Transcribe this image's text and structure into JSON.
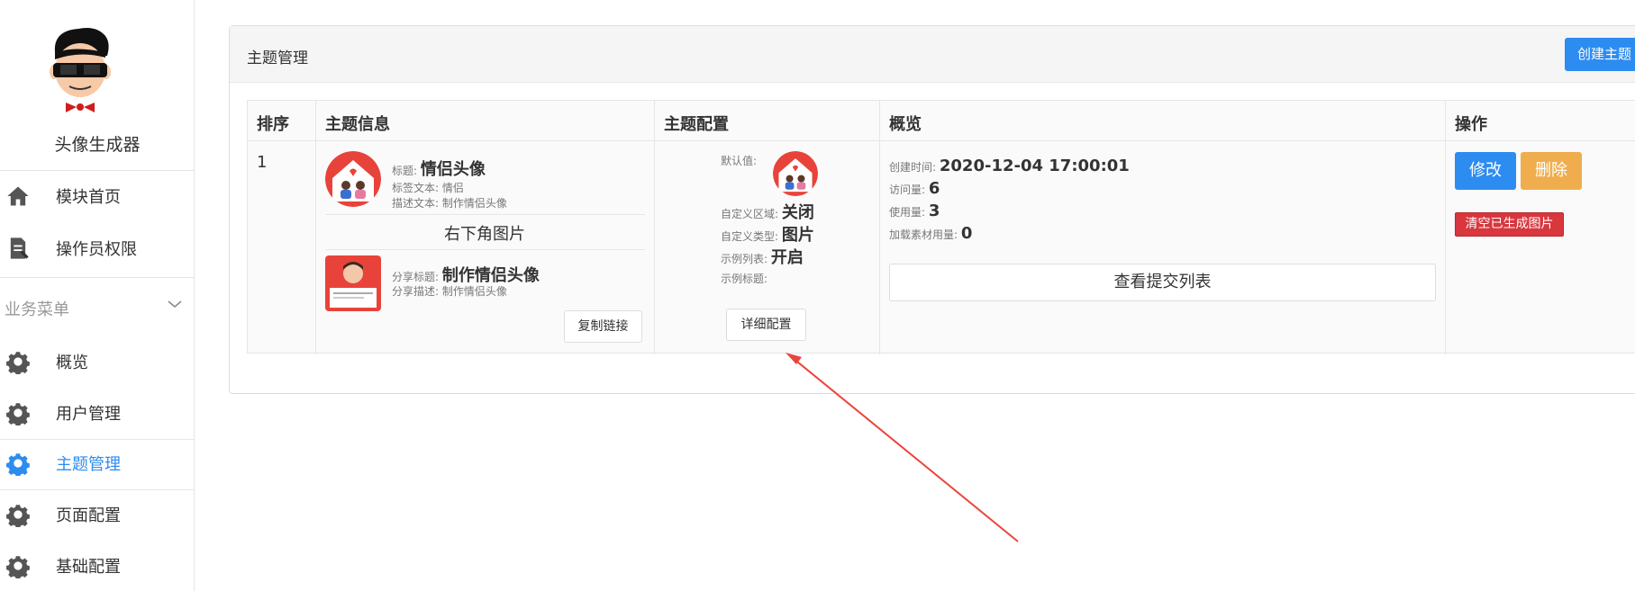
{
  "sidebar": {
    "app_name": "头像生成器",
    "items": [
      {
        "label": "模块首页",
        "icon": "home-icon"
      },
      {
        "label": "操作员权限",
        "icon": "document-edit-icon"
      }
    ],
    "group_title": "业务菜单",
    "group_items": [
      {
        "label": "概览",
        "icon": "gear-icon"
      },
      {
        "label": "用户管理",
        "icon": "gear-icon"
      },
      {
        "label": "主题管理",
        "icon": "gear-icon",
        "active": true
      },
      {
        "label": "页面配置",
        "icon": "gear-icon"
      },
      {
        "label": "基础配置",
        "icon": "gear-icon"
      }
    ]
  },
  "panel": {
    "title": "主题管理",
    "create_button": "创建主题"
  },
  "table": {
    "headers": [
      "排序",
      "主题信息",
      "主题配置",
      "概览",
      "操作"
    ],
    "row": {
      "order": "1",
      "info": {
        "title_label": "标题:",
        "title_value": "情侣头像",
        "tag_label": "标签文本:",
        "tag_value": "情侣",
        "desc_label": "描述文本:",
        "desc_value": "制作情侣头像",
        "corner_image_label": "右下角图片",
        "share_title_label": "分享标题:",
        "share_title_value": "制作情侣头像",
        "share_desc_label": "分享描述:",
        "share_desc_value": "制作情侣头像",
        "copy_link_button": "复制链接"
      },
      "config": {
        "default_label": "默认值:",
        "custom_area_label": "自定义区域:",
        "custom_area_value": "关闭",
        "custom_type_label": "自定义类型:",
        "custom_type_value": "图片",
        "example_list_label": "示例列表:",
        "example_list_value": "开启",
        "example_title_label": "示例标题:",
        "detail_button": "详细配置"
      },
      "overview": {
        "created_label": "创建时间:",
        "created_value": "2020-12-04 17:00:01",
        "visits_label": "访问量:",
        "visits_value": "6",
        "uses_label": "使用量:",
        "uses_value": "3",
        "material_label": "加载素材用量:",
        "material_value": "0",
        "submissions_button": "查看提交列表"
      },
      "actions": {
        "edit": "修改",
        "delete": "删除",
        "clear": "清空已生成图片"
      }
    }
  },
  "colors": {
    "primary": "#2d8cf0",
    "warning": "#f0ad4e",
    "danger": "#d9363e",
    "arrow": "#e8453c"
  }
}
